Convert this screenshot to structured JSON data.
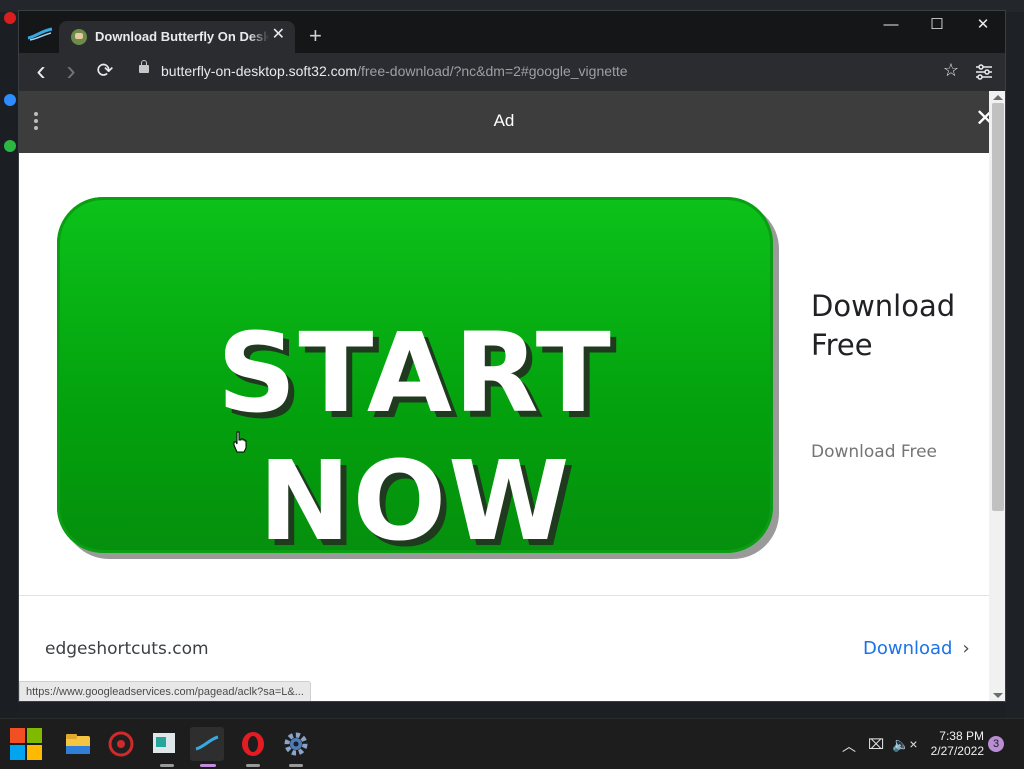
{
  "browser": {
    "tab_title": "Download Butterfly On Desktop",
    "tab_close": "✕",
    "new_tab": "+",
    "window_controls": {
      "minimize": "—",
      "maximize": "☐",
      "close": "✕"
    },
    "nav": {
      "back": "‹",
      "forward": "›",
      "reload": "⟳"
    },
    "url_host": "butterfly-on-desktop.soft32.com",
    "url_path": "/free-download/?nc&dm=2#google_vignette",
    "bookmark_star": "☆"
  },
  "ad": {
    "bar_label": "Ad",
    "close": "✕",
    "button_text": "START NOW",
    "headline": "Download Free",
    "subtext": "Download Free",
    "advertiser_domain": "edgeshortcuts.com",
    "cta_label": "Download",
    "cta_chevron": "›"
  },
  "status_bar_url": "https://www.googleadservices.com/pagead/aclk?sa=L&...",
  "taskbar": {
    "time": "7:38 PM",
    "date": "2/27/2022",
    "notification_count": "3",
    "tray_chevron": "︿",
    "tray_network": "⌧",
    "tray_volume": "🔈×",
    "apps": [
      "start-menu",
      "file-explorer",
      "security-app",
      "notes-app",
      "butterfly-app",
      "opera-browser",
      "settings"
    ]
  },
  "colors": {
    "start_button": "#0cc21a",
    "link": "#1a73e8",
    "ad_bar": "#3d3d3d"
  }
}
